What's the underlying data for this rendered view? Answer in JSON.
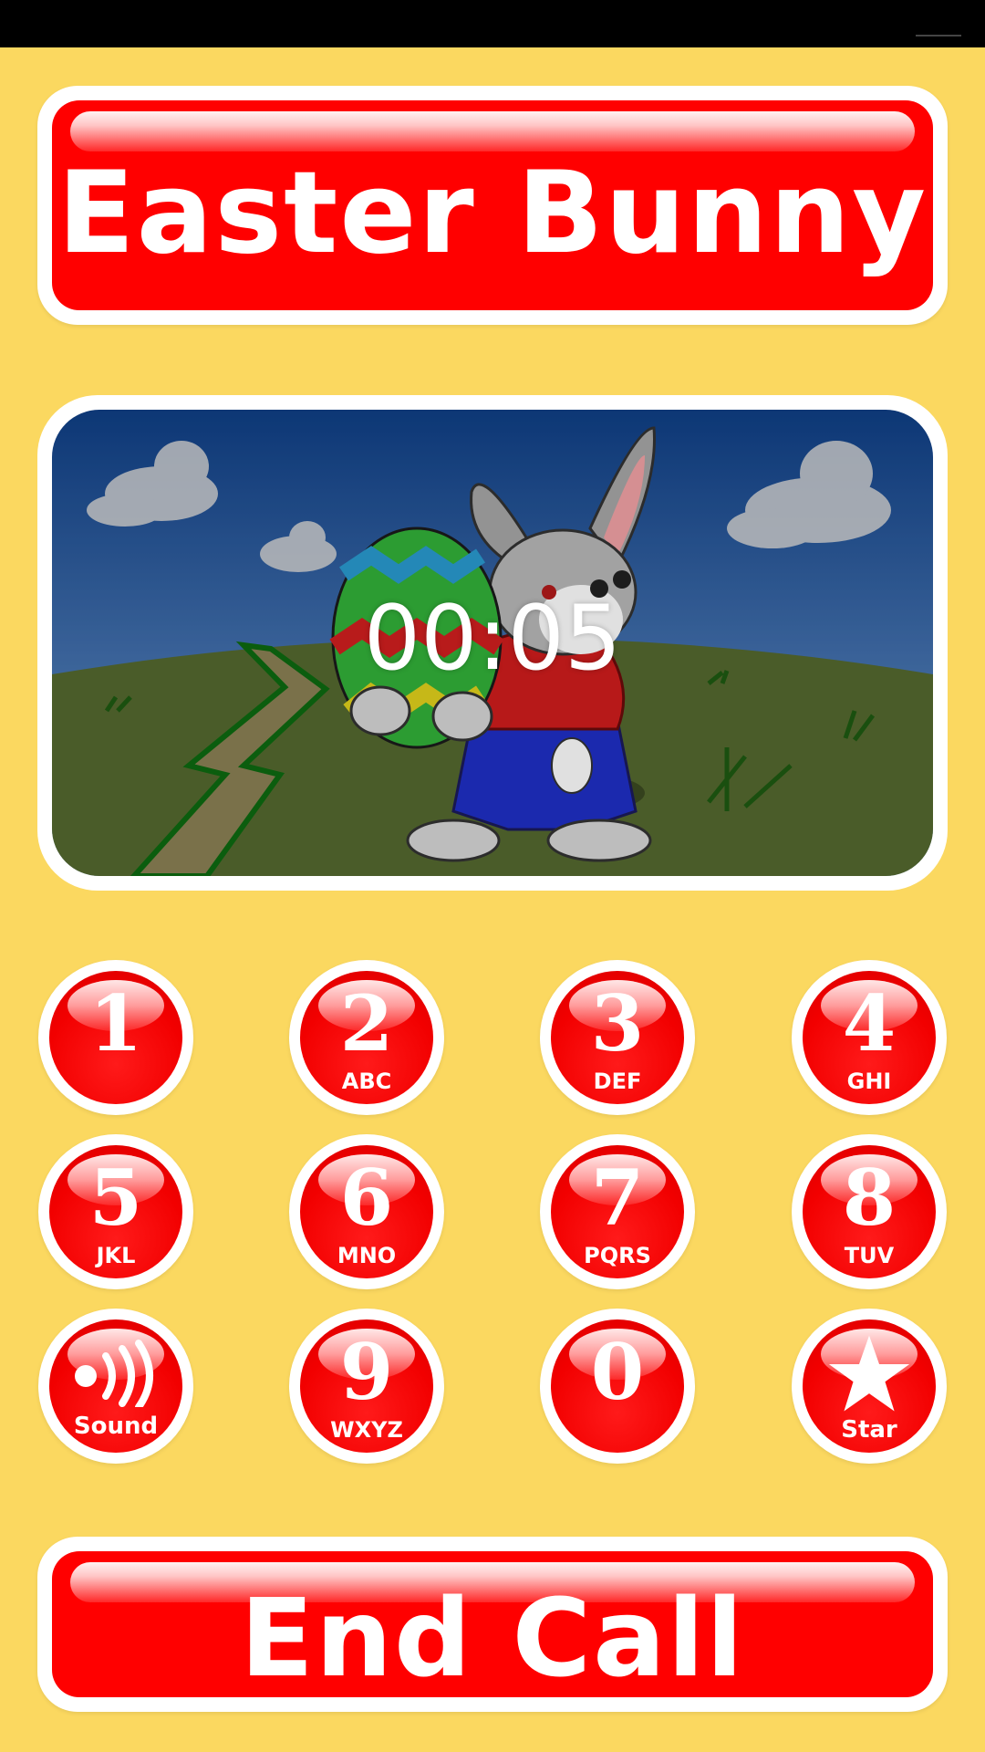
{
  "title": "Easter Bunny",
  "timer": "00:05",
  "end_call_label": "End Call",
  "keypad": [
    {
      "digit": "1",
      "letters": ""
    },
    {
      "digit": "2",
      "letters": "ABC"
    },
    {
      "digit": "3",
      "letters": "DEF"
    },
    {
      "digit": "4",
      "letters": "GHI"
    },
    {
      "digit": "5",
      "letters": "JKL"
    },
    {
      "digit": "6",
      "letters": "MNO"
    },
    {
      "digit": "7",
      "letters": "PQRS"
    },
    {
      "digit": "8",
      "letters": "TUV"
    },
    {
      "sound_label": "Sound",
      "icon": "sound-icon"
    },
    {
      "digit": "9",
      "letters": "WXYZ"
    },
    {
      "digit": "0",
      "letters": ""
    },
    {
      "star_label": "Star",
      "icon": "star-icon"
    }
  ],
  "colors": {
    "background": "#FBD860",
    "button_red": "#FF0000",
    "white": "#FFFFFF",
    "status_bar": "#000000"
  },
  "scene": {
    "illustration": "easter-bunny-holding-egg"
  }
}
